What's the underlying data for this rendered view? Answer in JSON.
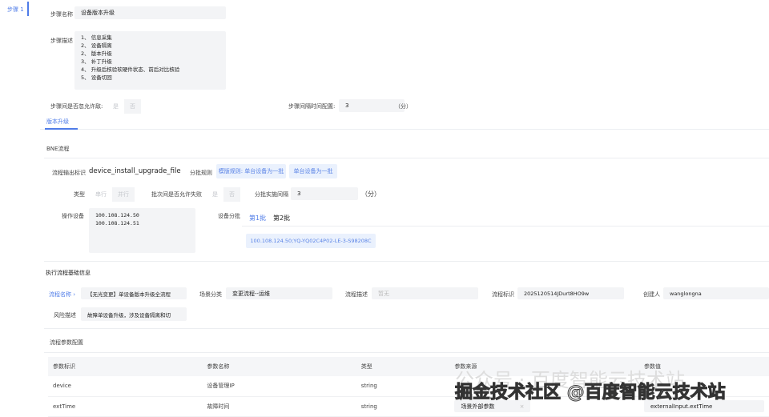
{
  "step": {
    "tab": "步骤 1",
    "name_label": "步骤名称",
    "name_value": "设备版本升级",
    "desc_label": "步骤描述",
    "desc_value": "1、 信息采集\n2、 设备隔离\n2、 版本升级\n3、 补丁升级\n4、 升级后核验软硬件状态、前后对比核验\n5、 设备切回",
    "ignore_label": "步骤间是否忽允许敌:",
    "yes": "是",
    "no": "否",
    "interval_label": "步骤间隔时间配置:",
    "interval_value": "3",
    "unit": "（分）"
  },
  "subtab": "版本升级",
  "bne": {
    "title": "BNE流程",
    "output_label": "流程输出标识",
    "output_value": "device_install_upgrade_file",
    "batch_rule_label": "分批规则",
    "rule1": "模版规则: 单台设备为一批",
    "rule2": "单台设备为一批",
    "type_label": "类型",
    "serial": "串行",
    "parallel": "并行",
    "allow_fail_label": "批次间是否允许失败",
    "yes": "是",
    "no": "否",
    "batch_interval_label": "分批实施间隔",
    "batch_interval_value": "3",
    "unit": "（分）",
    "devices_label": "操作设备",
    "devices_value": "100.108.124.50\n100.108.124.51",
    "device_batch_label": "设备分批",
    "batch1": "第1批",
    "batch2": "第2批",
    "batch_device": "100.108.124.50;YQ-YQ02C4P02-LE-3-S98208C"
  },
  "exec": {
    "title": "执行流程基础信息",
    "flow_name_label": "流程名称",
    "flow_name_value": "【无光变更】单设备版本升级全流程",
    "scene_label": "场景分类",
    "scene_value": "变更流程--运维",
    "flow_desc_label": "流程描述",
    "flow_desc_placeholder": "暂无",
    "flow_id_label": "流程标识",
    "flow_id_value": "2025120514JDurt8HO9w",
    "creator_label": "创建人",
    "creator_value": "wanglongna",
    "risk_label": "风险描述",
    "risk_value": "故障单设备升级，涉及设备隔离和切"
  },
  "params": {
    "title": "流程参数配置",
    "columns": [
      "参数标识",
      "参数名称",
      "类型",
      "参数来源",
      "参数值"
    ],
    "rows": [
      [
        "device",
        "设备管理IP",
        "string",
        "",
        ""
      ],
      [
        "extTime",
        "故障时间",
        "string",
        "场景外部参数",
        "externalInput.extTime"
      ]
    ]
  },
  "watermark": {
    "faded": "公众号 · 百度智能云技术站",
    "main": "掘金技术社区 @百度智能云技术站"
  }
}
